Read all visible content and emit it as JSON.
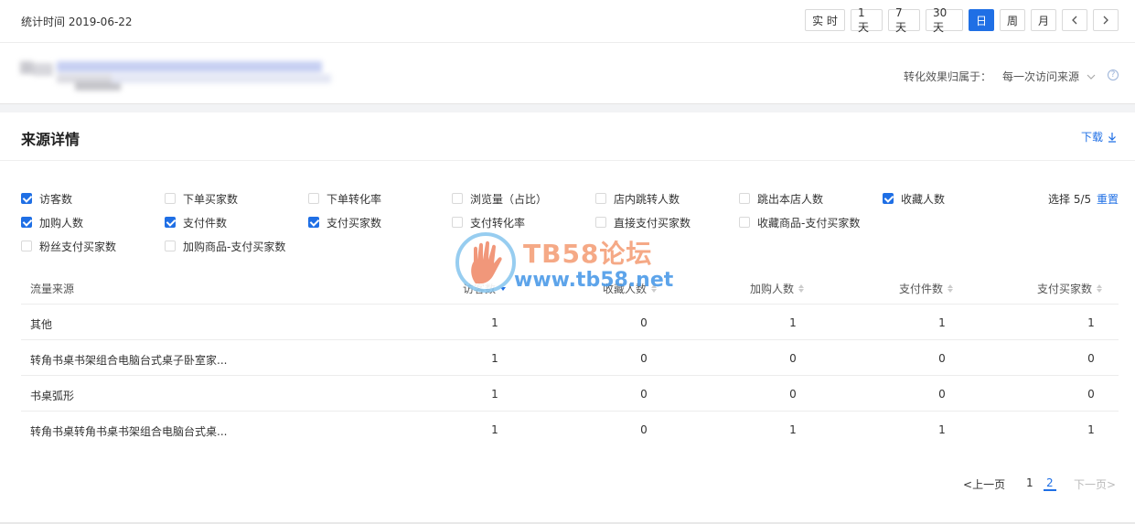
{
  "topbar": {
    "stat_time": "统计时间 2019-06-22",
    "periods": [
      "实 时",
      "1天",
      "7天",
      "30天",
      "日",
      "周",
      "月"
    ],
    "active_period": "日",
    "prev_icon": "chevron-left-icon",
    "next_icon": "chevron-right-icon"
  },
  "filter": {
    "attribution_label": "转化效果归属于：",
    "attribution_value": "每一次访问来源",
    "help_icon": "question-circle-icon"
  },
  "section": {
    "title": "来源详情",
    "download_label": "下载",
    "download_icon": "download-arrow-icon"
  },
  "metrics": [
    {
      "label": "访客数",
      "checked": true
    },
    {
      "label": "下单买家数",
      "checked": false
    },
    {
      "label": "下单转化率",
      "checked": false
    },
    {
      "label": "浏览量（占比）",
      "checked": false
    },
    {
      "label": "店内跳转人数",
      "checked": false
    },
    {
      "label": "跳出本店人数",
      "checked": false
    },
    {
      "label": "收藏人数",
      "checked": true
    },
    {
      "label": "加购人数",
      "checked": true
    },
    {
      "label": "支付件数",
      "checked": true
    },
    {
      "label": "支付买家数",
      "checked": true
    },
    {
      "label": "支付转化率",
      "checked": false
    },
    {
      "label": "直接支付买家数",
      "checked": false
    },
    {
      "label": "收藏商品-支付买家数",
      "checked": false
    },
    {
      "label": "粉丝支付买家数",
      "checked": false
    },
    {
      "label": "加购商品-支付买家数",
      "checked": false
    }
  ],
  "selection": {
    "count_text": "选择 5/5",
    "reset_label": "重置"
  },
  "table": {
    "headers": [
      "流量来源",
      "访客数",
      "收藏人数",
      "加购人数",
      "支付件数",
      "支付买家数"
    ],
    "rows": [
      [
        "其他",
        "1",
        "0",
        "1",
        "1",
        "1"
      ],
      [
        "转角书桌书架组合电脑台式桌子卧室家...",
        "1",
        "0",
        "0",
        "0",
        "0"
      ],
      [
        "书桌弧形",
        "1",
        "0",
        "0",
        "0",
        "0"
      ],
      [
        "转角书桌转角书桌书架组合电脑台式桌...",
        "1",
        "0",
        "1",
        "1",
        "1"
      ]
    ]
  },
  "watermark": {
    "line1": "TB58论坛",
    "line2": "www.tb58.net"
  },
  "pagination": {
    "prev": "上一页",
    "pages": [
      "1",
      "2"
    ],
    "current": "2",
    "next": "下一页"
  },
  "colors": {
    "accent": "#1f6fe5",
    "border": "#d9d9d9"
  }
}
